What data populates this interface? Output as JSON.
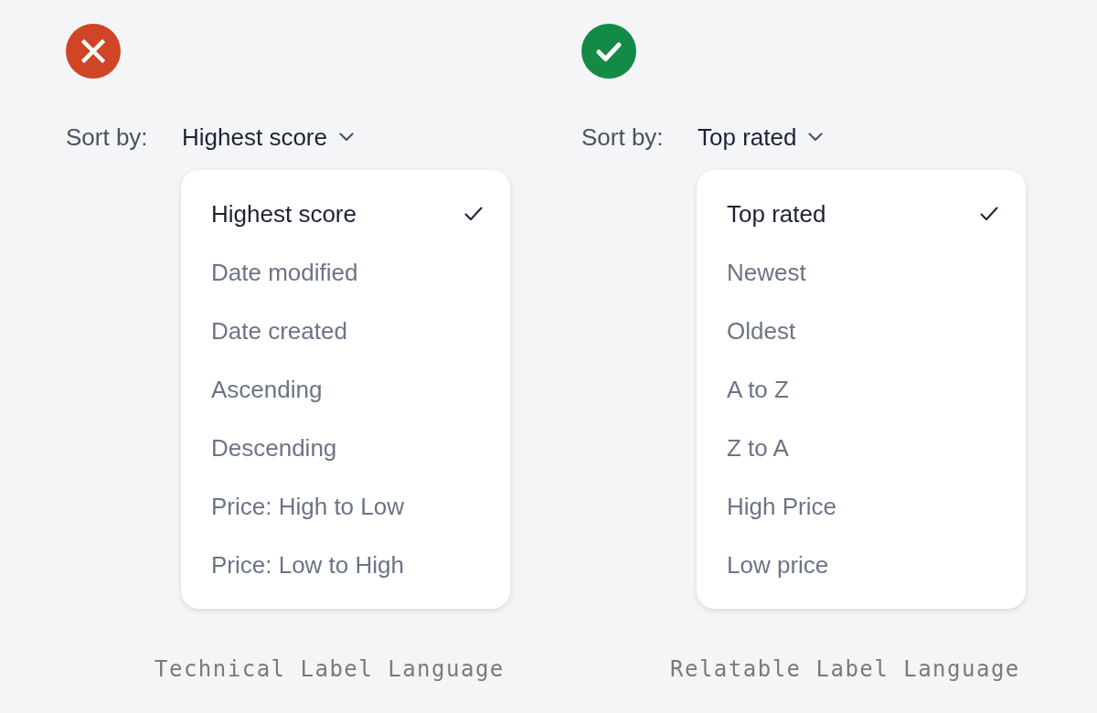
{
  "panels": [
    {
      "kind": "dont",
      "sort_label": "Sort by:",
      "sort_value": "Highest score",
      "options": [
        {
          "label": "Highest score",
          "selected": true
        },
        {
          "label": "Date modified",
          "selected": false
        },
        {
          "label": "Date created",
          "selected": false
        },
        {
          "label": "Ascending",
          "selected": false
        },
        {
          "label": "Descending",
          "selected": false
        },
        {
          "label": "Price: High to Low",
          "selected": false
        },
        {
          "label": "Price: Low to High",
          "selected": false
        }
      ],
      "caption": "Technical Label Language"
    },
    {
      "kind": "do",
      "sort_label": "Sort by:",
      "sort_value": "Top rated",
      "options": [
        {
          "label": "Top rated",
          "selected": true
        },
        {
          "label": "Newest",
          "selected": false
        },
        {
          "label": "Oldest",
          "selected": false
        },
        {
          "label": "A to Z",
          "selected": false
        },
        {
          "label": "Z to A",
          "selected": false
        },
        {
          "label": "High Price",
          "selected": false
        },
        {
          "label": "Low price",
          "selected": false
        }
      ],
      "caption": "Relatable Label Language"
    }
  ]
}
